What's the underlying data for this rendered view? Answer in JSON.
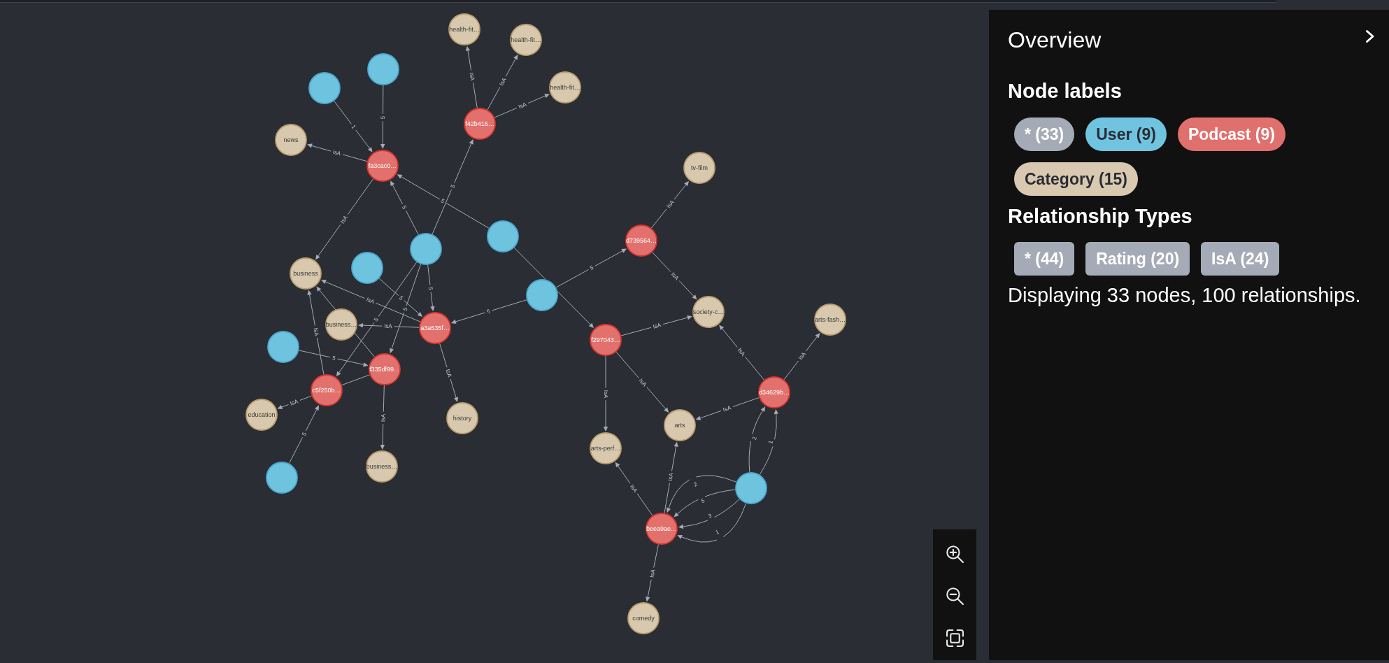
{
  "graph": {
    "nodes": [
      {
        "kind": "category",
        "caption": "health-fit…"
      },
      {
        "kind": "category",
        "caption": "health-fit…"
      },
      {
        "kind": "user"
      },
      {
        "kind": "category",
        "caption": "health-fit…"
      },
      {
        "kind": "user"
      },
      {
        "kind": "podcast",
        "caption": "f42b416…"
      },
      {
        "kind": "category",
        "caption": "news"
      },
      {
        "kind": "podcast",
        "caption": "fa3cac0…"
      },
      {
        "kind": "category",
        "caption": "tv-film"
      },
      {
        "kind": "user"
      },
      {
        "kind": "podcast",
        "caption": "d739564…"
      },
      {
        "kind": "user"
      },
      {
        "kind": "user"
      },
      {
        "kind": "category",
        "caption": "business"
      },
      {
        "kind": "user"
      },
      {
        "kind": "category",
        "caption": "society-c…"
      },
      {
        "kind": "category",
        "caption": "arts-fash…"
      },
      {
        "kind": "category",
        "caption": "business…"
      },
      {
        "kind": "podcast",
        "caption": "a3a535f…"
      },
      {
        "kind": "podcast",
        "caption": "f297043…"
      },
      {
        "kind": "user"
      },
      {
        "kind": "podcast",
        "caption": "f335df99…"
      },
      {
        "kind": "podcast",
        "caption": "c5f250b…"
      },
      {
        "kind": "podcast",
        "caption": "d34629b…"
      },
      {
        "kind": "category",
        "caption": "education"
      },
      {
        "kind": "category",
        "caption": "history"
      },
      {
        "kind": "category",
        "caption": "arts"
      },
      {
        "kind": "category",
        "caption": "arts-perf…"
      },
      {
        "kind": "category",
        "caption": "business…"
      },
      {
        "kind": "user"
      },
      {
        "kind": "user"
      },
      {
        "kind": "podcast",
        "caption": "beea9ae…"
      },
      {
        "kind": "category",
        "caption": "comedy"
      }
    ],
    "relationships": [
      {
        "label": "1"
      },
      {
        "label": "5"
      },
      {
        "label": "IsA"
      },
      {
        "label": "IsA"
      },
      {
        "label": "IsA"
      },
      {
        "label": "IsA"
      },
      {
        "label": "5"
      },
      {
        "label": "5"
      },
      {
        "label": "5"
      },
      {
        "label": "IsA"
      },
      {
        "label": "IsA"
      },
      {
        "label": "5"
      },
      {
        "label": "IsA"
      },
      {
        "label": "5"
      },
      {
        "label": "5"
      },
      {
        "label": "5"
      },
      {
        "label": "5"
      },
      {
        "label": "IsA"
      },
      {
        "label": "IsA"
      },
      {
        "label": "5"
      },
      {
        "label": "IsA"
      },
      {
        "label": "IsA"
      },
      {
        "label": "IsA"
      },
      {
        "label": "5"
      },
      {
        "label": "IsA"
      },
      {
        "label": "IsA"
      },
      {
        "label": "IsA"
      },
      {
        "label": "IsA"
      },
      {
        "label": "IsA"
      },
      {
        "label": "IsA"
      },
      {
        "label": "IsA"
      },
      {
        "label": "5"
      },
      {
        "label": "IsA"
      },
      {
        "label": "IsA"
      },
      {
        "label": "IsA"
      },
      {
        "label": "2"
      },
      {
        "label": "5"
      },
      {
        "label": "3"
      },
      {
        "label": "1"
      },
      {
        "label": "2"
      },
      {
        "label": "1"
      }
    ]
  },
  "overview": {
    "title": "Overview",
    "node_labels_heading": "Node labels",
    "node_labels": [
      {
        "label": "* (33)",
        "color": "#a5abb6"
      },
      {
        "label": "User (9)",
        "color": "#70c4e0"
      },
      {
        "label": "Podcast (9)",
        "color": "#e0706d"
      },
      {
        "label": "Category (15)",
        "color": "#d9c9b0"
      }
    ],
    "relationship_types_heading": "Relationship Types",
    "relationship_types": [
      {
        "label": "* (44)"
      },
      {
        "label": "Rating (20)"
      },
      {
        "label": "IsA (24)"
      }
    ],
    "summary": "Displaying 33 nodes, 100 relationships."
  }
}
